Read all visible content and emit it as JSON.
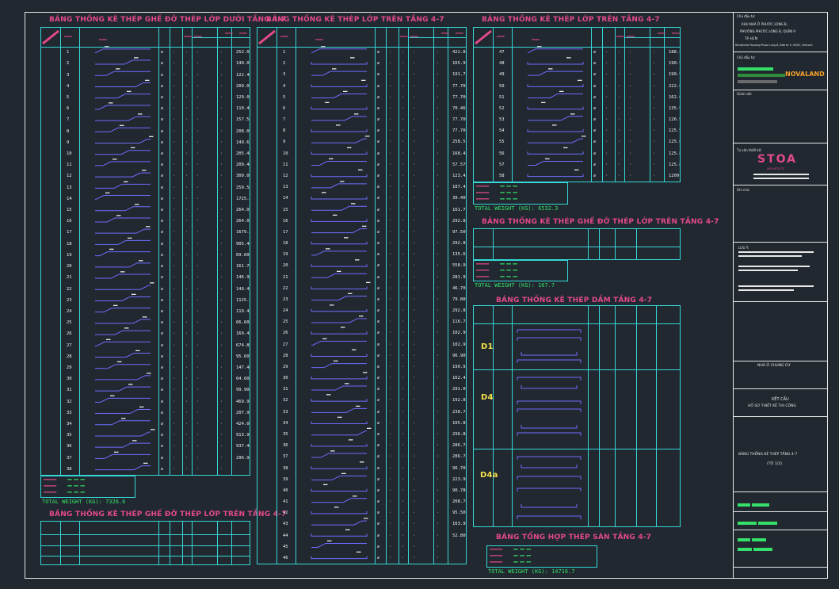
{
  "sheet": {
    "tables": [
      {
        "title": "BẢNG THỐNG KÊ THÉP GHẾ ĐỠ THÉP LỚP DƯỚI TẦNG 4-7"
      },
      {
        "title": "BẢNG THỐNG KÊ THÉP LỚP TRÊN TẦNG 4-7"
      },
      {
        "title": "BẢNG THỐNG KÊ THÉP LỚP TRÊN TẦNG 4-7"
      },
      {
        "title": "BẢNG THỐNG KÊ THÉP GHẾ ĐỠ THÉP LỚP TRÊN TẦNG 4-7"
      },
      {
        "title": "BẢNG THỐNG KÊ THÉP DẦM TẦNG 4-7"
      },
      {
        "title": "BẢNG THỐNG KÊ THÉP GHẾ ĐỠ THÉP LỚP TRÊN TẦNG 4-7"
      },
      {
        "title": "BẢNG TỔNG HỢP THÉP SÀN TẦNG 4-7"
      }
    ],
    "totals": [
      "TOTAL WEIGHT (KG): 7326.6",
      "TOTAL WEIGHT (KG): 6532.3",
      "TOTAL WEIGHT (KG): 167.7",
      "TOTAL WEIGHT (KG): 14716.7"
    ],
    "beam_labels": [
      "D1",
      "D4",
      "D4a"
    ],
    "row_ids_left": [
      "1",
      "2",
      "3",
      "4",
      "5",
      "6",
      "7",
      "8",
      "9",
      "10",
      "11",
      "12",
      "13",
      "14",
      "15",
      "16",
      "17",
      "18",
      "19",
      "20",
      "21",
      "22",
      "23",
      "24",
      "25",
      "26",
      "27",
      "28",
      "29",
      "30",
      "31",
      "32",
      "33",
      "34",
      "35",
      "36",
      "37",
      "38"
    ],
    "row_ids_mid": [
      "1",
      "2",
      "3",
      "4",
      "5",
      "6",
      "7",
      "8",
      "9",
      "10",
      "11",
      "12",
      "13",
      "14",
      "15",
      "16",
      "17",
      "18",
      "19",
      "20",
      "21",
      "22",
      "23",
      "24",
      "25",
      "26",
      "27",
      "28",
      "29",
      "30",
      "31",
      "32",
      "33",
      "34",
      "35",
      "36",
      "37",
      "38",
      "39",
      "40",
      "41",
      "42",
      "43",
      "44",
      "45",
      "46"
    ],
    "row_ids_right": [
      "47",
      "48",
      "49",
      "50",
      "51",
      "52",
      "53",
      "54",
      "55",
      "56",
      "57",
      "58"
    ],
    "weights_left": [
      "252.000",
      "140.000",
      "122.400",
      "209.000",
      "129.000",
      "110.400",
      "157.500",
      "208.000",
      "149.650",
      "205.400",
      "209.400",
      "300.000",
      "259.500",
      "1725.200",
      "264.000",
      "264.000",
      "1679.800",
      "905.400",
      "69.600",
      "161.700",
      "146.900",
      "149.400",
      "1125.200",
      "119.400",
      "66.600",
      "169.400",
      "674.800",
      "95.600",
      "147.400",
      "64.600",
      "99.900",
      "469.900",
      "207.900",
      "424.000",
      "913.900",
      "937.400",
      "296.900"
    ],
    "weights_mid": [
      "422.800",
      "165.900",
      "191.700",
      "77.700",
      "77.700",
      "70.460",
      "77.700",
      "77.700",
      "258.570",
      "168.400",
      "57.570",
      "123.450",
      "107.450",
      "39.400",
      "161.790",
      "292.800",
      "97.500",
      "292.800",
      "135.600",
      "558.900",
      "281.900",
      "46.700",
      "79.800",
      "292.800",
      "116.700",
      "102.900",
      "102.900",
      "96.900",
      "190.950",
      "162.450",
      "291.000",
      "192.800",
      "238.700",
      "105.800",
      "296.800",
      "286.700",
      "286.700",
      "96.700",
      "223.900",
      "90.780",
      "208.700",
      "95.500",
      "163.900",
      "52.800"
    ],
    "weights_right": [
      "188.450",
      "190.950",
      "190.950",
      "222.000",
      "162.600",
      "135.990",
      "126.900",
      "125.900",
      "125.800",
      "125.800",
      "125.800",
      "1209.900"
    ],
    "titleblock": {
      "owner": "Chủ đầu tư:",
      "project_line1": "KHU NHÀ Ở PHƯỚC LONG B,",
      "project_line2": "PHƯỜNG PHƯỚC LONG B, QUẬN 9",
      "project_line3": "TP. HCM",
      "project_en": "Residential Housing Phuoc Long B, District 9, HCMC, Vietnam",
      "investor": "Chủ đầu tư:",
      "investor_logo": "NOVALAND",
      "consultant_label": "Giám sát:",
      "designer_label": "Tư vấn thiết kế:",
      "designer_logo": "STOA",
      "designer_sub": "ARCHITECTS",
      "notes_label": "Ghi chú:",
      "notes_head": "LƯU Ý:",
      "building": "NHÀ Ở CHUNG CƯ",
      "discipline": "KẾT CẤU",
      "stage": "HỒ SƠ THIẾT KẾ THI CÔNG",
      "drawing_name": "BẢNG THỐNG KÊ THÉP TẦNG 4-7",
      "drawing_sub": "(TỜ 1/2)"
    }
  }
}
